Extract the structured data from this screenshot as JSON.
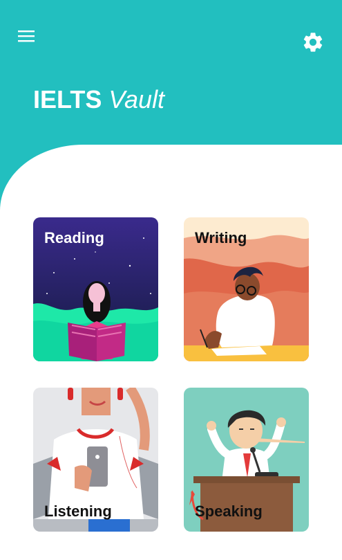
{
  "app": {
    "title_bold": "IELTS",
    "title_italic": "Vault"
  },
  "header": {
    "menu_icon": "hamburger-menu-icon",
    "settings_icon": "gear-icon"
  },
  "colors": {
    "header": "#22bfbf",
    "background": "#ffffff"
  },
  "cards": {
    "reading": {
      "label": "Reading"
    },
    "writing": {
      "label": "Writing"
    },
    "listening": {
      "label": "Listening"
    },
    "speaking": {
      "label": "Speaking"
    }
  }
}
